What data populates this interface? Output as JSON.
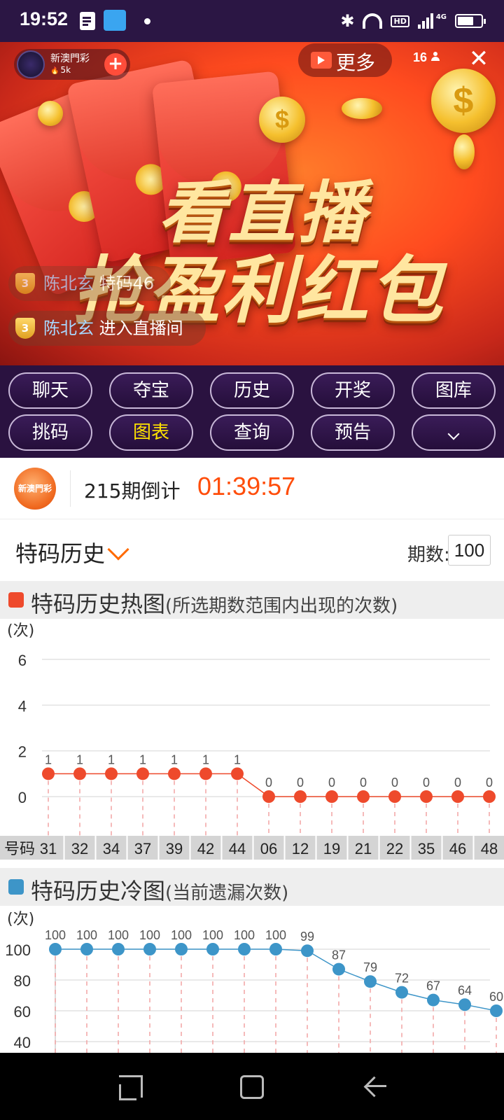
{
  "status_bar": {
    "time": "19:52",
    "network": "4G",
    "hd_badge": "HD"
  },
  "host": {
    "name": "新澳門彩",
    "fans": "5k",
    "follow_symbol": "+"
  },
  "top_bar": {
    "more_label": "更多",
    "viewer_count": "16",
    "close_symbol": "✕"
  },
  "banner": {
    "slogan_line1": "看直播",
    "slogan_line2": "抢盈利红包",
    "coin_symbol": "$"
  },
  "chat_messages": [
    {
      "level": "3",
      "user": "陈北玄",
      "text": "特码46"
    },
    {
      "level": "3",
      "user": "陈北玄",
      "text": "进入直播间"
    }
  ],
  "tabs": {
    "row1": [
      "聊天",
      "夺宝",
      "历史",
      "开奖",
      "图库"
    ],
    "row2": [
      "挑码",
      "图表",
      "查询",
      "预告"
    ],
    "active": "图表"
  },
  "countdown": {
    "logo_text": "新澳門彩",
    "label": "215期倒计",
    "timer": "01:39:57"
  },
  "section": {
    "title": "特码历史",
    "period_label": "期数:",
    "period_value": "100"
  },
  "hot_chart_title": {
    "main": "特码历史热图",
    "sub": "(所选期数范围内出现的次数)"
  },
  "cold_chart_title": {
    "main": "特码历史冷图",
    "sub": "(当前遗漏次数)"
  },
  "colors": {
    "hot": "#ee4a2c",
    "cold": "#3d95c8",
    "accent": "#ff4d0a",
    "tab_active": "#ffe200"
  },
  "chart_data": [
    {
      "type": "line",
      "title": "特码历史热图",
      "ylabel": "(次)",
      "x_axis_label": "号码",
      "ylim": [
        0,
        6
      ],
      "yticks": [
        0,
        2,
        4,
        6
      ],
      "grid": true,
      "categories": [
        "31",
        "32",
        "34",
        "37",
        "39",
        "42",
        "44",
        "06",
        "12",
        "19",
        "21",
        "22",
        "35",
        "46",
        "48"
      ],
      "values": [
        1,
        1,
        1,
        1,
        1,
        1,
        1,
        0,
        0,
        0,
        0,
        0,
        0,
        0,
        0
      ]
    },
    {
      "type": "line",
      "title": "特码历史冷图",
      "ylabel": "(次)",
      "ylim": [
        40,
        100
      ],
      "yticks": [
        40,
        60,
        80,
        100
      ],
      "grid": true,
      "values": [
        100,
        100,
        100,
        100,
        100,
        100,
        100,
        100,
        99,
        87,
        79,
        72,
        67,
        64,
        60
      ]
    }
  ]
}
